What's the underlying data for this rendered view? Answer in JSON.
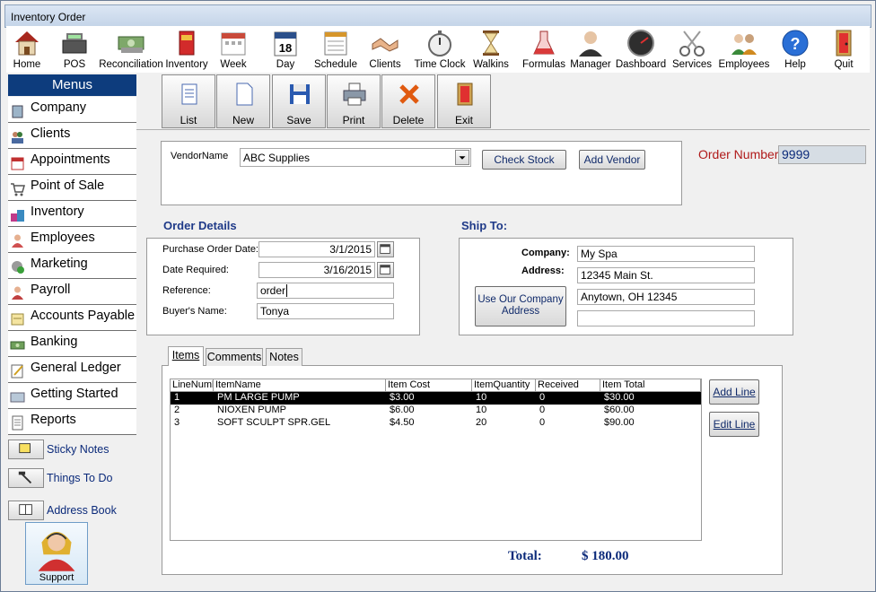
{
  "window": {
    "title": "Inventory Order"
  },
  "toolbar": [
    {
      "label": "Home",
      "icon": "home-icon"
    },
    {
      "label": "POS",
      "icon": "cash-register-icon"
    },
    {
      "label": "Reconciliation",
      "icon": "money-icon"
    },
    {
      "label": "Inventory",
      "icon": "products-icon"
    },
    {
      "label": "Week",
      "icon": "week-calendar-icon"
    },
    {
      "label": "Day",
      "icon": "day-calendar-icon"
    },
    {
      "label": "Schedule",
      "icon": "schedule-icon"
    },
    {
      "label": "Clients",
      "icon": "handshake-icon"
    },
    {
      "label": "Time Clock",
      "icon": "stopwatch-icon"
    },
    {
      "label": "Walkins",
      "icon": "hourglass-icon"
    },
    {
      "label": "Formulas",
      "icon": "flask-icon"
    },
    {
      "label": "Manager",
      "icon": "manager-icon"
    },
    {
      "label": "Dashboard",
      "icon": "gauge-icon"
    },
    {
      "label": "Services",
      "icon": "scissors-icon"
    },
    {
      "label": "Employees",
      "icon": "employees-icon"
    },
    {
      "label": "Help",
      "icon": "help-icon"
    },
    {
      "label": "Quit",
      "icon": "exit-door-icon"
    }
  ],
  "menus": {
    "header": "Menus",
    "items": [
      "Company",
      "Clients",
      "Appointments",
      "Point of Sale",
      "Inventory",
      "Employees",
      "Marketing",
      "Payroll",
      "Accounts Payable",
      "Banking",
      "General Ledger",
      "Getting Started",
      "Reports"
    ],
    "extras": [
      "Sticky Notes",
      "Things To Do",
      "Address Book"
    ],
    "support": "Support"
  },
  "actions": [
    "List",
    "New",
    "Save",
    "Print",
    "Delete",
    "Exit"
  ],
  "vendor": {
    "label": "VendorName",
    "value": "ABC Supplies",
    "check_stock": "Check Stock",
    "add_vendor": "Add Vendor"
  },
  "order_number": {
    "label": "Order Number",
    "value": "9999"
  },
  "order_details": {
    "heading": "Order Details",
    "po_date_label": "Purchase Order Date:",
    "po_date": "3/1/2015",
    "date_required_label": "Date Required:",
    "date_required": "3/16/2015",
    "reference_label": "Reference:",
    "reference": "order",
    "buyer_label": "Buyer's Name:",
    "buyer": "Tonya"
  },
  "ship_to": {
    "heading": "Ship To:",
    "company_label": "Company:",
    "company": "My Spa",
    "address_label": "Address:",
    "address1": "12345 Main St.",
    "address2": "Anytown, OH 12345",
    "address3": "",
    "use_company_button": "Use Our Company Address"
  },
  "tabs": [
    "Items",
    "Comments",
    "Notes"
  ],
  "items_table": {
    "headers": [
      "LineNumb",
      "ItemName",
      "Item Cost",
      "ItemQuantity",
      "Received",
      "Item Total"
    ],
    "rows": [
      [
        "1",
        "PM LARGE PUMP",
        "$3.00",
        "10",
        "0",
        "$30.00"
      ],
      [
        "2",
        "NIOXEN PUMP",
        "$6.00",
        "10",
        "0",
        "$60.00"
      ],
      [
        "3",
        "SOFT SCULPT SPR.GEL",
        "$4.50",
        "20",
        "0",
        "$90.00"
      ]
    ]
  },
  "item_buttons": {
    "add_line": "Add Line",
    "edit_line": "Edit Line"
  },
  "total": {
    "label": "Total:",
    "value": "$ 180.00"
  },
  "colors": {
    "menu_header": "#0d3c7d",
    "heading": "#1f3a88",
    "order_number_label": "#b01a1a"
  }
}
